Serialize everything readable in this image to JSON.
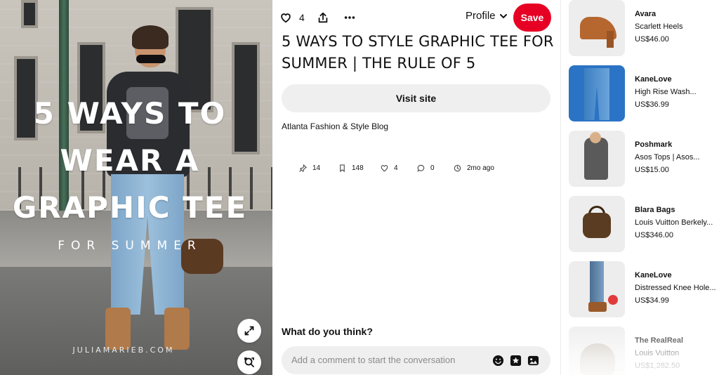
{
  "pin_image": {
    "overlay_title_lines": [
      "5 WAYS TO",
      "WEAR A",
      "GRAPHIC TEE"
    ],
    "overlay_subtitle": "FOR SUMMER",
    "overlay_credit": "JULIAMARIEB.COM",
    "buttons": [
      {
        "name": "expand-button",
        "icon": "expand-arrows-icon"
      },
      {
        "name": "visual-search-button",
        "icon": "visual-search-icon"
      }
    ]
  },
  "action_bar": {
    "like_count": "4",
    "profile_label": "Profile",
    "save_label": "Save",
    "accent": "#e60023"
  },
  "pin": {
    "title": "5 WAYS TO STYLE GRAPHIC TEE FOR SUMMER | THE RULE OF 5",
    "visit_label": "Visit site",
    "source": "Atlanta Fashion & Style Blog",
    "stats": [
      {
        "icon": "pin-icon",
        "value": "14"
      },
      {
        "icon": "saves-icon",
        "value": "148"
      },
      {
        "icon": "heart-icon",
        "value": "4"
      },
      {
        "icon": "comment-icon",
        "value": "0"
      },
      {
        "icon": "clock-icon",
        "value": "2mo ago"
      }
    ]
  },
  "comments": {
    "heading": "What do you think?",
    "placeholder": "Add a comment to start the conversation"
  },
  "products": [
    {
      "brand": "Avara",
      "name": "Scarlett Heels",
      "price": "US$46.00"
    },
    {
      "brand": "KaneLove",
      "name": "High Rise Wash...",
      "price": "US$36.99"
    },
    {
      "brand": "Poshmark",
      "name": "Asos Tops | Asos...",
      "price": "US$15.00"
    },
    {
      "brand": "Blara Bags",
      "name": "Louis Vuitton Berkely...",
      "price": "US$346.00"
    },
    {
      "brand": "KaneLove",
      "name": "Distressed Knee Hole...",
      "price": "US$34.99"
    },
    {
      "brand": "The RealReal",
      "name": "Louis Vuitton",
      "price": "US$1,282.50"
    }
  ]
}
